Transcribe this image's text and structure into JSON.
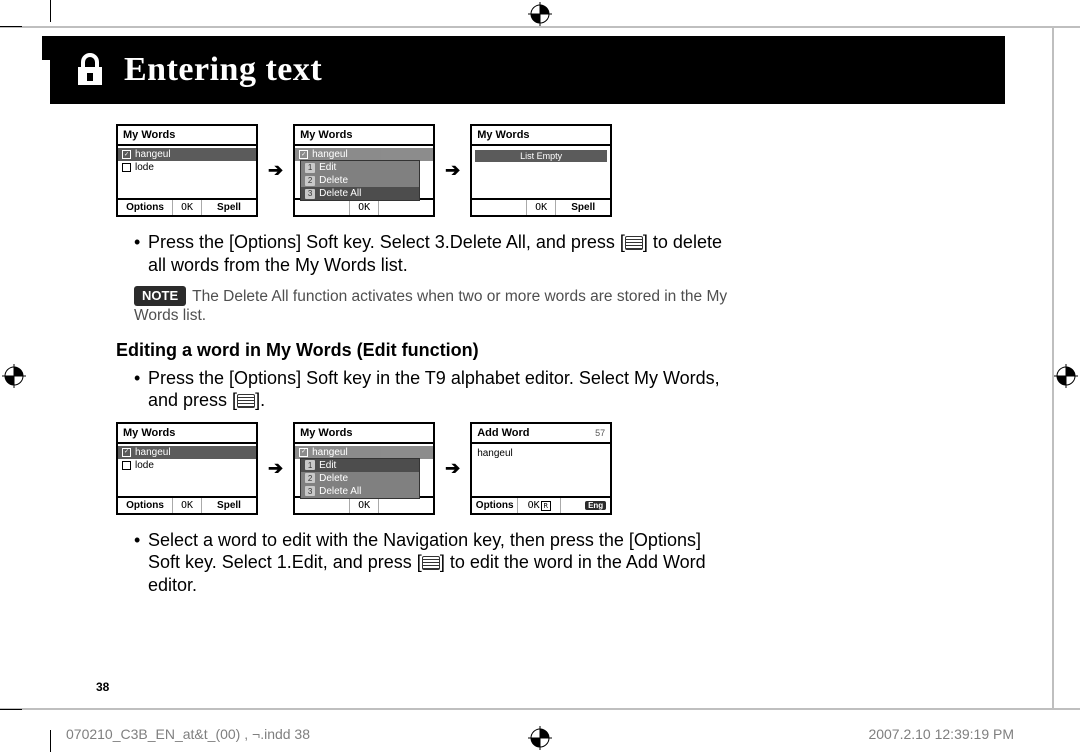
{
  "header": {
    "title": "Entering text"
  },
  "row1": {
    "screen1": {
      "title": "My Words",
      "items": [
        {
          "label": "hangeul",
          "selected": true
        },
        {
          "label": "lode",
          "selected": false
        }
      ],
      "sk_left": "Options",
      "sk_mid": "OK",
      "sk_right": "Spell"
    },
    "screen2": {
      "title": "My Words",
      "ghost_item": "hangeul",
      "menu": [
        {
          "n": "1",
          "label": "Edit",
          "selected": false
        },
        {
          "n": "2",
          "label": "Delete",
          "selected": false
        },
        {
          "n": "3",
          "label": "Delete All",
          "selected": true
        }
      ],
      "sk_mid": "OK"
    },
    "screen3": {
      "title": "My Words",
      "empty_label": "List Empty",
      "sk_mid": "OK",
      "sk_right": "Spell"
    }
  },
  "para1a": "Press the [Options] Soft key. Select 3.Delete All, and press [",
  "para1b": "] to delete all words from the My Words list.",
  "note_badge": "NOTE",
  "note_text": "The Delete All function activates when two or more words are stored in the My Words list.",
  "subhead": "Editing a word in My Words (Edit function)",
  "para2a": "Press the [Options] Soft key in the T9 alphabet editor. Select My Words, and press [",
  "para2b": "].",
  "row2": {
    "screen1": {
      "title": "My Words",
      "items": [
        {
          "label": "hangeul",
          "selected": true
        },
        {
          "label": "lode",
          "selected": false
        }
      ],
      "sk_left": "Options",
      "sk_mid": "OK",
      "sk_right": "Spell"
    },
    "screen2": {
      "title": "My Words",
      "ghost_item": "hangeul",
      "menu": [
        {
          "n": "1",
          "label": "Edit",
          "selected": true
        },
        {
          "n": "2",
          "label": "Delete",
          "selected": false
        },
        {
          "n": "3",
          "label": "Delete All",
          "selected": false
        }
      ],
      "sk_mid": "OK"
    },
    "screen3": {
      "title": "Add Word",
      "counter": "57",
      "input_value": "hangeul",
      "sk_left": "Options",
      "sk_mid": "OK",
      "lang": "Eng"
    }
  },
  "para3a": "Select a word to edit with the Navigation key, then press the [Options] Soft key. Select 1.Edit, and press [",
  "para3b": "] to edit the word in the Add Word editor.",
  "page_number": "38",
  "footer_left": "070210_C3B_EN_at&t_(00) , ¬.indd   38",
  "footer_right": "2007.2.10   12:39:19 PM"
}
